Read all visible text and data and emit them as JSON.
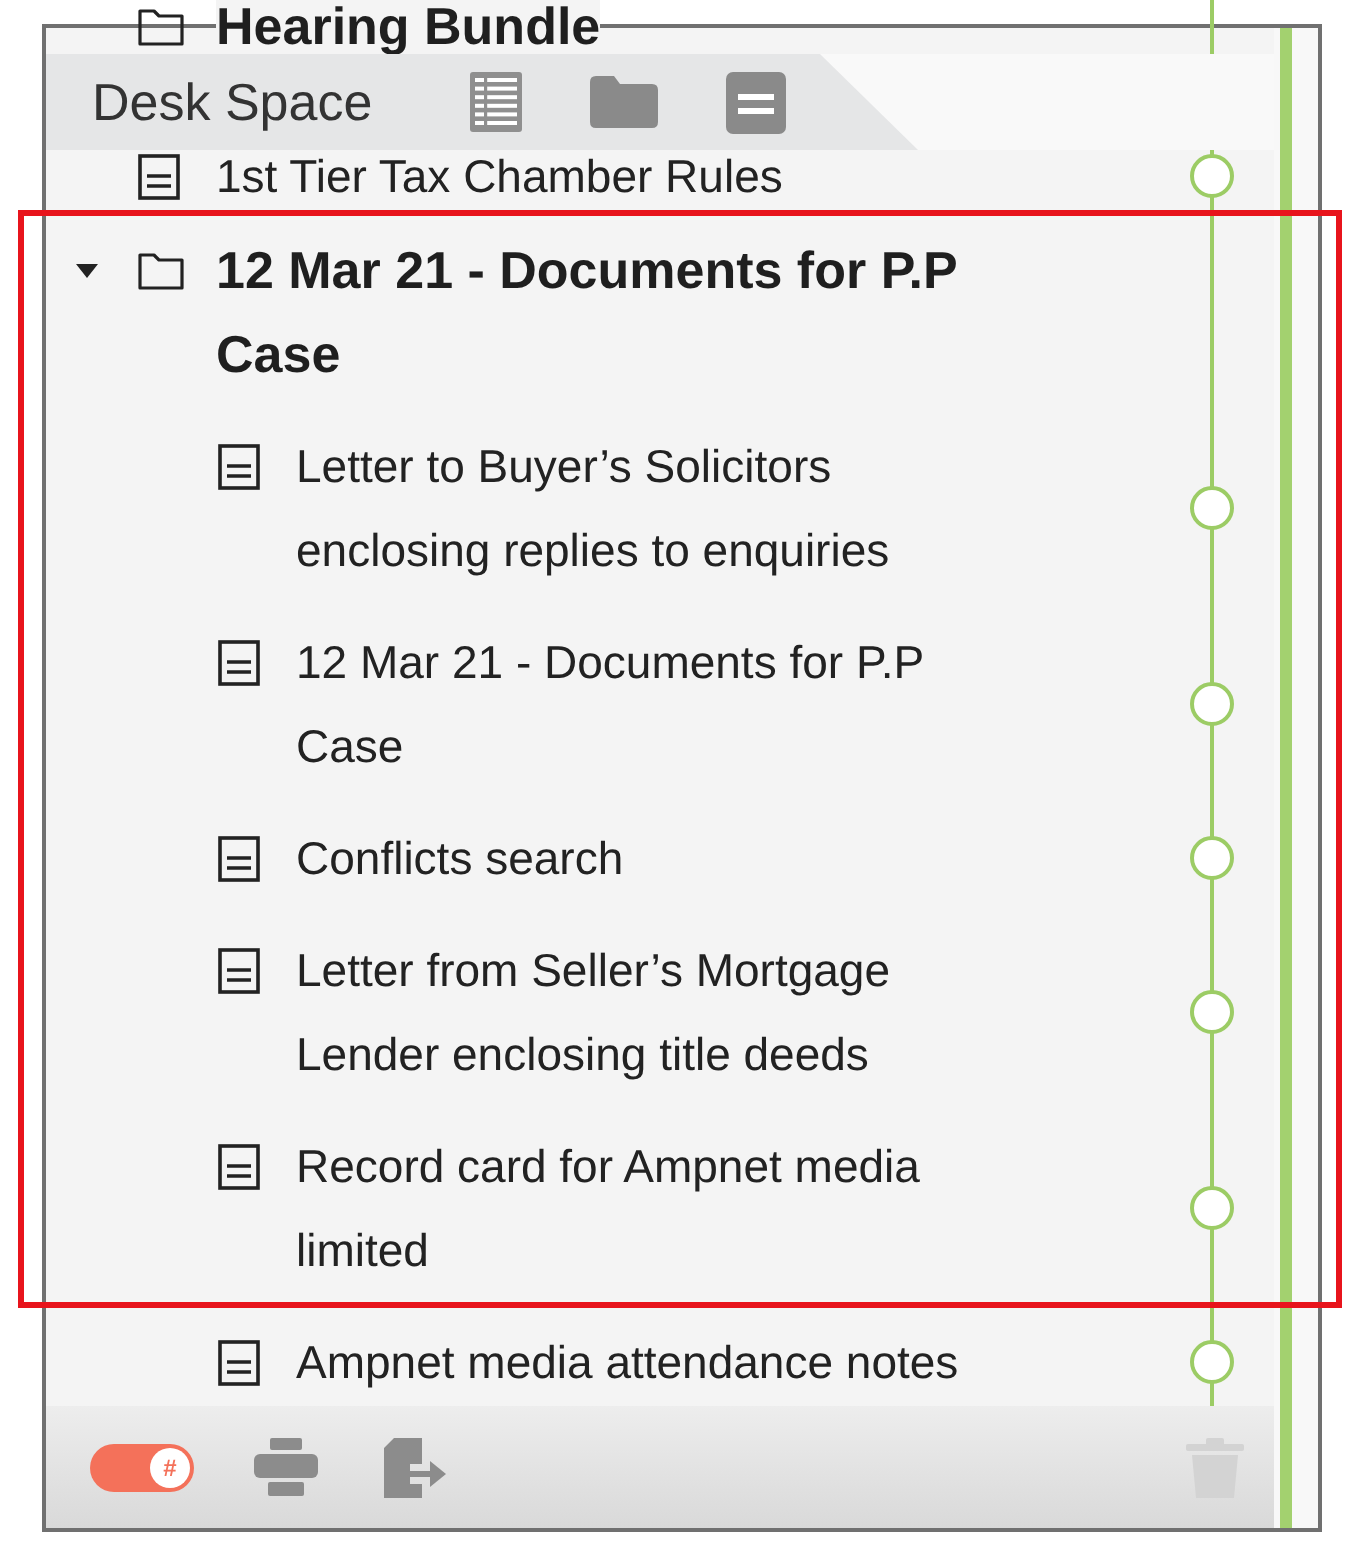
{
  "header": {
    "title": "Desk Space"
  },
  "tree": [
    {
      "kind": "folder",
      "label": "Hearing Bundle"
    },
    {
      "kind": "document",
      "label": "1st Tier Tax Chamber Rules"
    },
    {
      "kind": "folder",
      "label": "12 Mar 21 - Documents for P.P Case",
      "expanded": true,
      "children": [
        {
          "kind": "document",
          "label": "Letter to Buyer’s Solicitors enclosing replies to enquiries"
        },
        {
          "kind": "document",
          "label": "12 Mar 21 - Documents for P.P Case"
        },
        {
          "kind": "document",
          "label": "Conflicts search"
        },
        {
          "kind": "document",
          "label": "Letter from Seller’s Mortgage Lender enclosing title deeds"
        },
        {
          "kind": "document",
          "label": "Record card for Ampnet media limited"
        },
        {
          "kind": "document",
          "label": "Ampnet media attendance notes"
        }
      ]
    }
  ],
  "toolbar": {
    "toggle": {
      "label": "#",
      "on": true
    },
    "trash": {
      "disabled": true
    }
  }
}
